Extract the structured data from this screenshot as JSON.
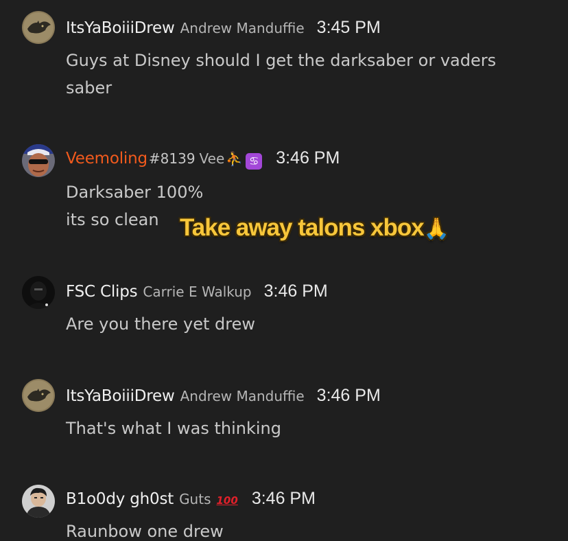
{
  "messages": [
    {
      "gamertag": "ItsYaBoiiiDrew",
      "realname": "Andrew Manduffie",
      "time": "3:45 PM",
      "lines": [
        "Guys at Disney should I get the darksaber or vaders",
        "saber"
      ],
      "avatar": "dragon-avatar"
    },
    {
      "gamertag": "Veemoling",
      "discriminator": "#8139",
      "realname": "Vee",
      "badges": [
        "basketball-player-icon",
        "cancer-zodiac-icon"
      ],
      "badge_glyphs": [
        "⛹",
        "♋"
      ],
      "time": "3:46 PM",
      "lines": [
        "Darksaber 100%",
        "its so clean"
      ],
      "avatar": "sunglasses-avatar",
      "gamertag_color": "#f25a1d"
    },
    {
      "gamertag": "FSC Clips",
      "realname": "Carrie E Walkup",
      "time": "3:46 PM",
      "lines": [
        "Are you there yet drew"
      ],
      "avatar": "dark-avatar"
    },
    {
      "gamertag": "ItsYaBoiiiDrew",
      "realname": "Andrew Manduffie",
      "time": "3:46 PM",
      "lines": [
        "That's what I was thinking"
      ],
      "avatar": "dragon-avatar"
    },
    {
      "gamertag": "B1o0dy gh0st",
      "realname": "Guts",
      "badges": [
        "hundred-points-icon"
      ],
      "badge_glyphs": [
        "100"
      ],
      "time": "3:46 PM",
      "lines": [
        "Raunbow one drew"
      ],
      "avatar": "person-avatar"
    }
  ],
  "overlay": {
    "caption": "Take away talons xbox",
    "emoji": "🙏",
    "emoji_name": "folded-hands-icon",
    "color": "#f7c63a"
  },
  "colors": {
    "background": "#1f1f1f",
    "orange_gamertag": "#f25a1d",
    "zodiac_badge": "#a347d8"
  }
}
